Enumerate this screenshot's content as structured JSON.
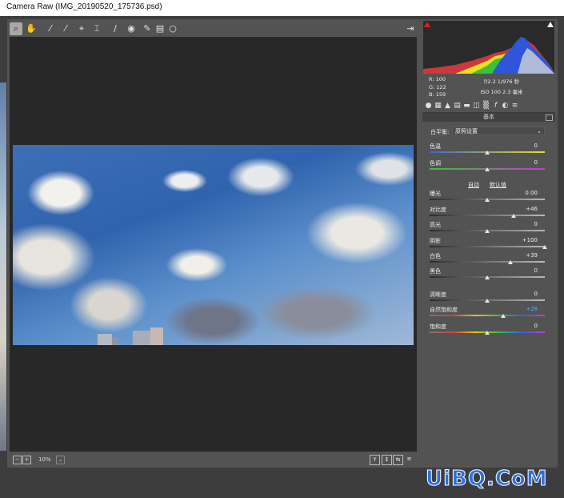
{
  "window": {
    "title": "Camera Raw (IMG_20190520_175736.psd)"
  },
  "toolbar": {
    "tools": [
      {
        "name": "zoom-tool",
        "glyph": "⌕",
        "active": true
      },
      {
        "name": "hand-tool",
        "glyph": "✋"
      },
      {
        "name": "white-balance-tool",
        "glyph": "⁄"
      },
      {
        "name": "color-sampler-tool",
        "glyph": "⁄"
      },
      {
        "name": "targeted-adjustment-tool",
        "glyph": "⌖"
      },
      {
        "name": "crop-tool",
        "glyph": "⌶"
      },
      {
        "name": "spot-removal-tool",
        "glyph": "∕"
      },
      {
        "name": "red-eye-tool",
        "glyph": "◉"
      },
      {
        "name": "adjustment-brush-tool",
        "glyph": "✎"
      },
      {
        "name": "graduated-filter-tool",
        "glyph": "▤"
      },
      {
        "name": "radial-filter-tool",
        "glyph": "○"
      }
    ],
    "open_preferences_glyph": "⇥"
  },
  "status": {
    "zoom_out": "−",
    "zoom_in": "+",
    "zoom": "10%",
    "zoom_dropdown": "⌄",
    "buttons": [
      "Y",
      "↕",
      "⇆",
      "≡"
    ]
  },
  "readout": {
    "r": "R:  100",
    "g": "G:  122",
    "b": "B:  159",
    "exposure": "f/2.2  1/976 秒",
    "iso": "ISO 100  2.3 毫米"
  },
  "panel": {
    "section_title": "基本",
    "wb_label": "白平衡:",
    "wb_value": "原照设置",
    "auto": "自动",
    "default": "默认值",
    "sliders": [
      {
        "label": "色温",
        "value": "0",
        "pos": 0.5,
        "track": "temp"
      },
      {
        "label": "色调",
        "value": "0",
        "pos": 0.5,
        "track": "tint"
      },
      {
        "label": "曝光",
        "value": "0.00",
        "pos": 0.5,
        "track": "gray"
      },
      {
        "label": "对比度",
        "value": "+46",
        "pos": 0.73,
        "track": "gray"
      },
      {
        "label": "高光",
        "value": "0",
        "pos": 0.5,
        "track": "gray"
      },
      {
        "label": "阴影",
        "value": "+100",
        "pos": 1.0,
        "track": "gray"
      },
      {
        "label": "白色",
        "value": "+39",
        "pos": 0.7,
        "track": "gray"
      },
      {
        "label": "黑色",
        "value": "0",
        "pos": 0.5,
        "track": "gray"
      },
      {
        "label": "清晰度",
        "value": "0",
        "pos": 0.5,
        "track": "gray"
      },
      {
        "label": "自然饱和度",
        "value": "+28",
        "pos": 0.64,
        "track": "vib",
        "highlight": true
      },
      {
        "label": "饱和度",
        "value": "0",
        "pos": 0.5,
        "track": "sat"
      }
    ]
  },
  "watermark": "UiBQ.CoM",
  "colors": {
    "panel_bg": "#535353",
    "canvas_bg": "#282828",
    "accent_value": "#59a6ff"
  }
}
